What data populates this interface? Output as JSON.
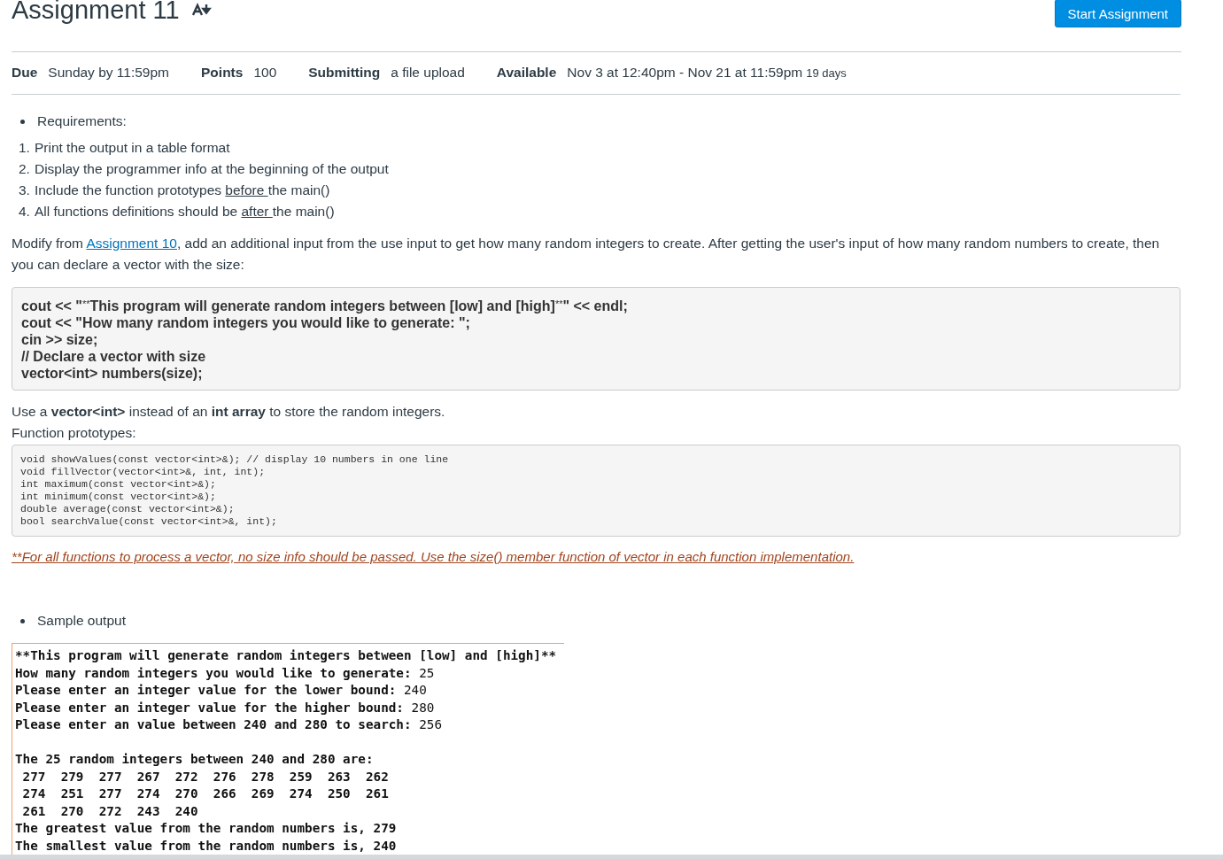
{
  "title": "Assignment 11",
  "start_button": "Start Assignment",
  "details": [
    {
      "label": "Due",
      "value": "Sunday by 11:59pm"
    },
    {
      "label": "Points",
      "value": "100"
    },
    {
      "label": "Submitting",
      "value": "a file upload"
    },
    {
      "label": "Available",
      "value": "Nov 3 at 12:40pm - Nov 21 at 11:59pm",
      "note": "19 days"
    }
  ],
  "requirements_heading": "Requirements:",
  "requirements": [
    {
      "number": "1.",
      "parts": [
        {
          "kind": "text",
          "text": "Print the output in a table format"
        }
      ]
    },
    {
      "number": "2.",
      "parts": [
        {
          "kind": "text",
          "text": "Display the programmer info at the beginning of the output"
        }
      ]
    },
    {
      "number": "3.",
      "parts": [
        {
          "kind": "text",
          "text": "Include the function prototypes "
        },
        {
          "kind": "underline",
          "text": "before "
        },
        {
          "kind": "text",
          "text": "the main()"
        }
      ]
    },
    {
      "number": "4.",
      "parts": [
        {
          "kind": "text",
          "text": "All functions definitions should be "
        },
        {
          "kind": "underline",
          "text": "after "
        },
        {
          "kind": "text",
          "text": "the main()"
        }
      ]
    }
  ],
  "intro": [
    {
      "kind": "text",
      "text": "Modify from "
    },
    {
      "kind": "link",
      "text": "Assignment 10"
    },
    {
      "kind": "text",
      "text": ", add an additional input from the use input to get how many random integers to create. After getting the user's input of how many random numbers to create, then you can declare a vector with the size:"
    }
  ],
  "code_snippet": [
    [
      {
        "kind": "text",
        "text": "cout << \""
      },
      {
        "kind": "small",
        "text": "**"
      },
      {
        "kind": "text",
        "text": "This program will generate random integers between [low] and [high]"
      },
      {
        "kind": "small",
        "text": "**"
      },
      {
        "kind": "text",
        "text": "\" << endl;"
      }
    ],
    [
      {
        "kind": "text",
        "text": "cout << \"How many random integers you would like to generate: \";"
      }
    ],
    [
      {
        "kind": "text",
        "text": "cin >> size;"
      }
    ],
    [
      {
        "kind": "text",
        "text": "// Declare a vector with size"
      }
    ],
    [
      {
        "kind": "text",
        "text": "vector<int> numbers(size);"
      }
    ]
  ],
  "use_note": "Use a **vector<int>** instead of an **int array** to store the random integers.",
  "prototypes_heading": "Function prototypes:",
  "prototypes": [
    "void showValues(const vector<int>&); // display 10 numbers in one line",
    "void fillVector(vector<int>&, int, int);",
    "int maximum(const vector<int>&);",
    "int minimum(const vector<int>&);",
    "double average(const vector<int>&);",
    "bool searchValue(const vector<int>&, int);"
  ],
  "footnote": "**For all functions to process a vector, no size info should be passed. Use the size() member function of vector in each function implementation.",
  "sample_heading": "Sample output",
  "sample_output": [
    {
      "kind": "line",
      "text": "**This program will generate random integers between [low] and [high]**"
    },
    {
      "kind": "line",
      "text": "How many random integers you would like to generate: ",
      "input": "25"
    },
    {
      "kind": "line",
      "text": "Please enter an integer value for the lower bound: ",
      "input": "240"
    },
    {
      "kind": "line",
      "text": "Please enter an integer value for the higher bound: ",
      "input": "280"
    },
    {
      "kind": "line",
      "text": "Please enter an value between 240 and 280 to search: ",
      "input": "256"
    },
    {
      "kind": "blank"
    },
    {
      "kind": "line",
      "text": "The 25 random integers between 240 and 280 are:"
    },
    {
      "kind": "line",
      "text": " 277  279  277  267  272  276  278  259  263  262"
    },
    {
      "kind": "line",
      "text": " 274  251  277  274  270  266  269  274  250  261"
    },
    {
      "kind": "line",
      "text": " 261  270  272  243  240"
    },
    {
      "kind": "line",
      "text": "The greatest value from the random numbers is, 279"
    },
    {
      "kind": "line",
      "text": "The smallest value from the random numbers is, 240"
    }
  ]
}
